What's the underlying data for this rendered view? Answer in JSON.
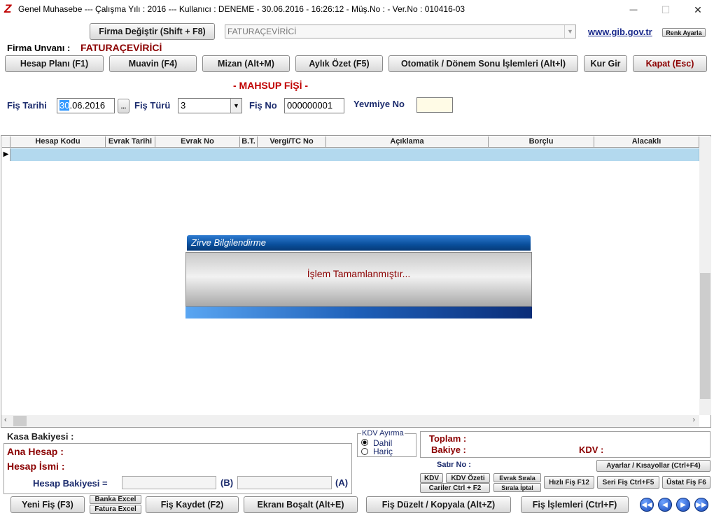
{
  "titlebar": {
    "logo": "Z",
    "title": "Genel Muhasebe  ---  Çalışma Yılı : 2016  ---  Kullanıcı : DENEME - 30.06.2016 - 16:26:12 - Müş.No :  - Ver.No : 010416-03",
    "minimize": "—",
    "maximize": "☐",
    "close": "✕"
  },
  "top": {
    "firma_degistir": "Firma Değiştir (Shift + F8)",
    "firma_select": "FATURAÇEVİRİCİ",
    "gib_link": "www.gib.gov.tr",
    "renk_ayarla": "Renk Ayarla",
    "firma_unvani_label": "Firma Unvanı :",
    "firma_unvani_value": "FATURAÇEVİRİCİ"
  },
  "toolbar": {
    "hesap_plani": "Hesap Planı (F1)",
    "muavin": "Muavin (F4)",
    "mizan": "Mizan (Alt+M)",
    "aylik_ozet": "Aylık Özet (F5)",
    "otomatik": "Otomatik / Dönem Sonu İşlemleri (Alt+İ)",
    "kur_gir": "Kur Gir",
    "kapat": "Kapat (Esc)"
  },
  "form": {
    "heading": "- MAHSUP FİŞİ -",
    "fis_tarihi_label": "Fiş Tarihi",
    "fis_tarihi_sel": "30",
    "fis_tarihi_rest": ".06.2016",
    "ellipsis": "...",
    "fis_turu_label": "Fiş Türü",
    "fis_turu_value": "3",
    "fis_no_label": "Fiş No",
    "fis_no_value": "000000001",
    "yevmiye_label": "Yevmiye No",
    "yevmiye_value": ""
  },
  "grid": {
    "columns": [
      "Hesap Kodu",
      "Evrak Tarihi",
      "Evrak No",
      "B.T.",
      "Vergi/TC No",
      "Açıklama",
      "Borçlu",
      "Alacaklı"
    ]
  },
  "dialog": {
    "title": "Zirve Bilgilendirme",
    "message": "İşlem Tamamlanmıştır..."
  },
  "bottom": {
    "kasa_bakiyesi": "Kasa Bakiyesi :",
    "ana_hesap": "Ana Hesap :",
    "hesap_ismi": "Hesap İsmi :",
    "hesap_bakiyesi": "Hesap Bakiyesi =",
    "b_label": "(B)",
    "a_label": "(A)",
    "kdv_ayirma_title": "KDV Ayırma",
    "dahil": "Dahil",
    "haric": "Hariç",
    "toplam": "Toplam :",
    "bakiye": "Bakiye :",
    "kdv": "KDV :",
    "satir_no": "Satır No :",
    "ayarlar": "Ayarlar / Kısayollar (Ctrl+F4)",
    "kdv_btn": "KDV",
    "kdv_ozeti": "KDV Özeti",
    "evrak_sirala": "Evrak Sırala",
    "cariler": "Cariler Ctrl + F2",
    "sirala_iptal": "Sırala İptal",
    "hizli_fis": "Hızlı Fiş F12",
    "seri_fis": "Seri Fiş Ctrl+F5",
    "ustat_fis": "Üstat Fiş F6",
    "yeni_fis": "Yeni Fiş (F3)",
    "banka_excel": "Banka Excel",
    "fatura_excel": "Fatura Excel",
    "fis_kaydet": "Fiş Kaydet (F2)",
    "ekrani_bosalt": "Ekranı Boşalt (Alt+E)",
    "fis_duzelt": "Fiş Düzelt / Kopyala (Alt+Z)",
    "fis_islemleri": "Fiş İşlemleri (Ctrl+F)"
  },
  "colors": {
    "accent_red": "#8b0000",
    "label_blue": "#1a2a6c",
    "row_highlight": "#b3d9ee",
    "dialog_title_bg": "#0a4f9c"
  }
}
